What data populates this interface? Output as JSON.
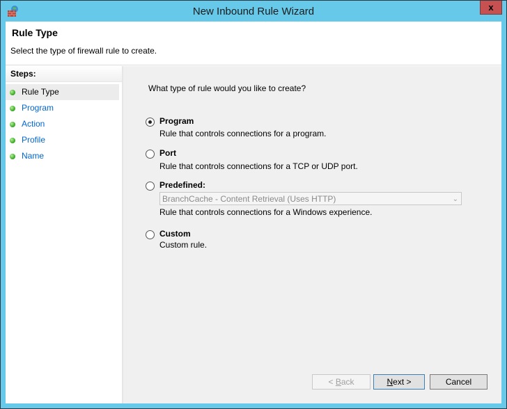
{
  "window": {
    "title": "New Inbound Rule Wizard",
    "close_label": "x",
    "app_icon": "firewall-icon"
  },
  "header": {
    "title": "Rule Type",
    "subtitle": "Select the type of firewall rule to create."
  },
  "steps": {
    "heading": "Steps:",
    "items": [
      {
        "label": "Rule Type",
        "current": true
      },
      {
        "label": "Program",
        "current": false
      },
      {
        "label": "Action",
        "current": false
      },
      {
        "label": "Profile",
        "current": false
      },
      {
        "label": "Name",
        "current": false
      }
    ]
  },
  "main": {
    "question": "What type of rule would you like to create?",
    "options": [
      {
        "label": "Program",
        "description": "Rule that controls connections for a program.",
        "selected": true
      },
      {
        "label": "Port",
        "description": "Rule that controls connections for a TCP or UDP port.",
        "selected": false
      },
      {
        "label": "Predefined:",
        "description": "Rule that controls connections for a Windows experience.",
        "selected": false,
        "dropdown_value": "BranchCache - Content Retrieval (Uses HTTP)"
      },
      {
        "label": "Custom",
        "description": "Custom rule.",
        "selected": false
      }
    ]
  },
  "buttons": {
    "back_prefix": "< ",
    "back_accel": "B",
    "back_rest": "ack",
    "next_accel": "N",
    "next_rest": "ext >",
    "cancel": "Cancel"
  },
  "colors": {
    "titlebar": "#66c9ea",
    "close": "#c75050",
    "link": "#0066cc"
  }
}
